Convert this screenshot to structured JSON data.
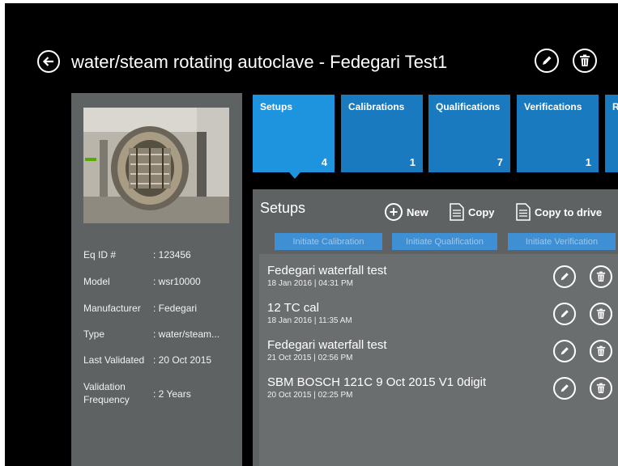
{
  "header": {
    "title": "water/steam rotating autoclave - Fedegari Test1",
    "back_icon": "back-arrow-icon",
    "edit_icon": "pencil-icon",
    "delete_icon": "trash-icon"
  },
  "equipment": {
    "fields": [
      {
        "label": "Eq ID #",
        "value": ": 123456"
      },
      {
        "label": "Model",
        "value": ": wsr10000"
      },
      {
        "label": "Manufacturer",
        "value": ": Fedegari"
      },
      {
        "label": "Type",
        "value": ": water/steam..."
      },
      {
        "label": "Last Validated",
        "value": ": 20 Oct 2015"
      },
      {
        "label": "Validation Frequency",
        "value": ": 2 Years"
      }
    ]
  },
  "tiles": [
    {
      "label": "Setups",
      "count": "4",
      "active": true
    },
    {
      "label": "Calibrations",
      "count": "1"
    },
    {
      "label": "Qualifications",
      "count": "7"
    },
    {
      "label": "Verifications",
      "count": "1"
    },
    {
      "label": "R",
      "count": ""
    }
  ],
  "setups": {
    "title": "Setups",
    "actions": {
      "new": "New",
      "copy": "Copy",
      "copy_to_drive": "Copy to drive"
    },
    "initiate_buttons": [
      "Initiate Calibration",
      "Initiate Qualification",
      "Initiate Verification"
    ],
    "items": [
      {
        "title": "Fedegari waterfall test",
        "date": "18 Jan 2016 | 04:31  PM"
      },
      {
        "title": "12 TC cal",
        "date": "18 Jan 2016 | 11:35  AM"
      },
      {
        "title": "Fedegari waterfall test",
        "date": "21 Oct 2015 | 02:56  PM"
      },
      {
        "title": "SBM BOSCH 121C 9 Oct 2015 V1 0digit",
        "date": "20 Oct 2015 | 02:25  PM"
      }
    ]
  },
  "colors": {
    "background": "#000000",
    "panel": "#5f6263",
    "tile": "#1a7ac0",
    "tile_active": "#1e93de",
    "init_button": "#3e8fd4"
  }
}
